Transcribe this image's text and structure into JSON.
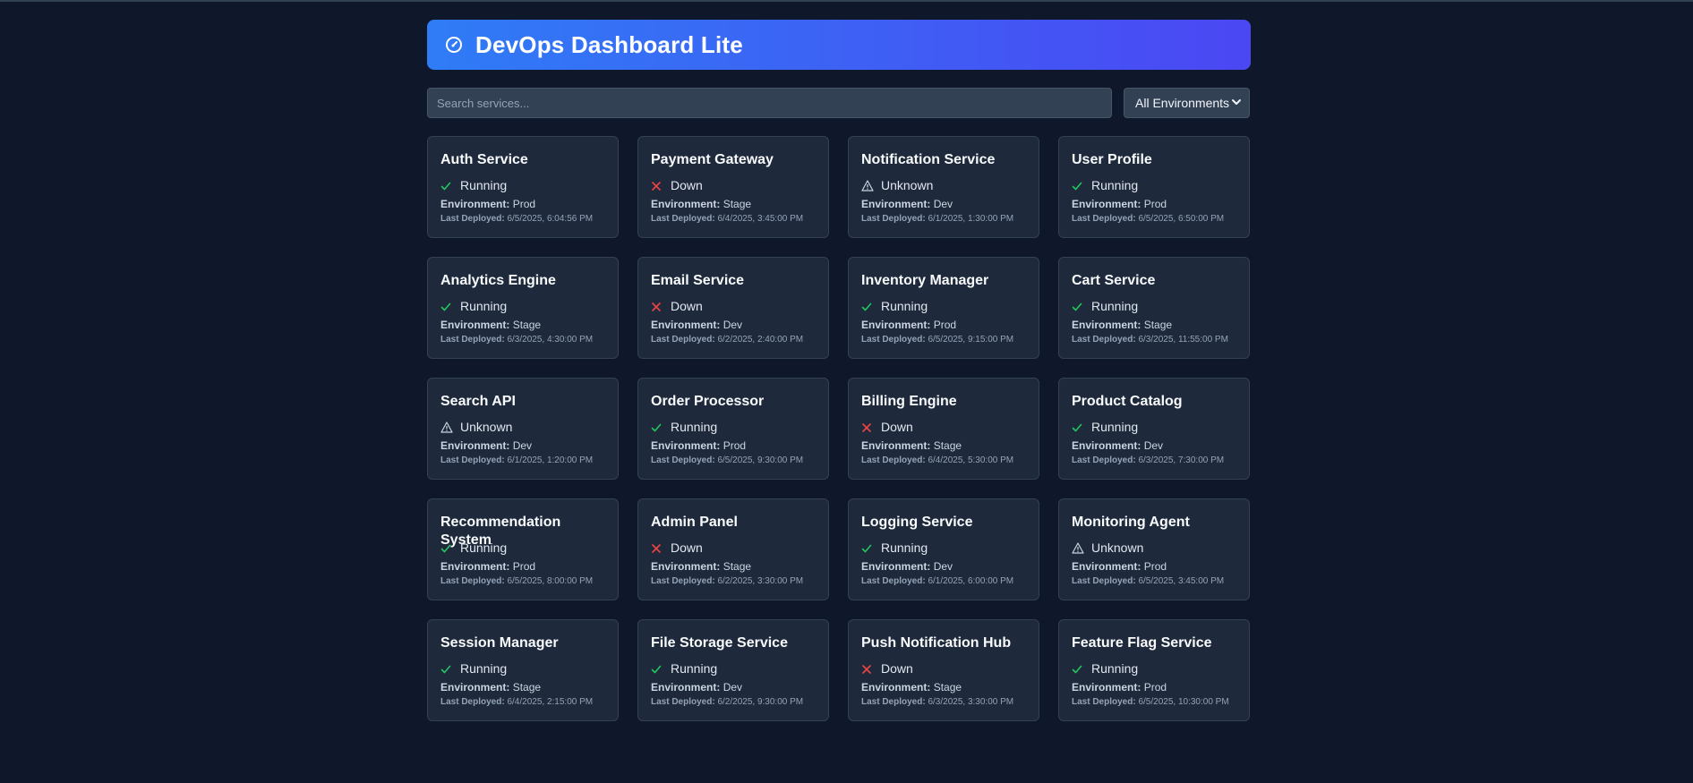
{
  "header": {
    "title": "DevOps Dashboard Lite",
    "icon": "gauge-icon"
  },
  "search": {
    "placeholder": "Search services..."
  },
  "filter": {
    "selected": "All Environments"
  },
  "labels": {
    "environment": "Environment:",
    "last_deployed": "Last Deployed:"
  },
  "colors": {
    "running": "#22c55e",
    "down": "#ef4444",
    "unknown": "#cbd5e1",
    "header_start": "#2f7cf6",
    "header_end": "#4b47f3"
  },
  "services": [
    {
      "name": "Auth Service",
      "status": "Running",
      "env": "Prod",
      "deployed": "6/5/2025, 6:04:56 PM"
    },
    {
      "name": "Payment Gateway",
      "status": "Down",
      "env": "Stage",
      "deployed": "6/4/2025, 3:45:00 PM"
    },
    {
      "name": "Notification Service",
      "status": "Unknown",
      "env": "Dev",
      "deployed": "6/1/2025, 1:30:00 PM"
    },
    {
      "name": "User Profile",
      "status": "Running",
      "env": "Prod",
      "deployed": "6/5/2025, 6:50:00 PM"
    },
    {
      "name": "Analytics Engine",
      "status": "Running",
      "env": "Stage",
      "deployed": "6/3/2025, 4:30:00 PM"
    },
    {
      "name": "Email Service",
      "status": "Down",
      "env": "Dev",
      "deployed": "6/2/2025, 2:40:00 PM"
    },
    {
      "name": "Inventory Manager",
      "status": "Running",
      "env": "Prod",
      "deployed": "6/5/2025, 9:15:00 PM"
    },
    {
      "name": "Cart Service",
      "status": "Running",
      "env": "Stage",
      "deployed": "6/3/2025, 11:55:00 PM"
    },
    {
      "name": "Search API",
      "status": "Unknown",
      "env": "Dev",
      "deployed": "6/1/2025, 1:20:00 PM"
    },
    {
      "name": "Order Processor",
      "status": "Running",
      "env": "Prod",
      "deployed": "6/5/2025, 9:30:00 PM"
    },
    {
      "name": "Billing Engine",
      "status": "Down",
      "env": "Stage",
      "deployed": "6/4/2025, 5:30:00 PM"
    },
    {
      "name": "Product Catalog",
      "status": "Running",
      "env": "Dev",
      "deployed": "6/3/2025, 7:30:00 PM"
    },
    {
      "name": "Recommendation System",
      "status": "Running",
      "env": "Prod",
      "deployed": "6/5/2025, 8:00:00 PM"
    },
    {
      "name": "Admin Panel",
      "status": "Down",
      "env": "Stage",
      "deployed": "6/2/2025, 3:30:00 PM"
    },
    {
      "name": "Logging Service",
      "status": "Running",
      "env": "Dev",
      "deployed": "6/1/2025, 6:00:00 PM"
    },
    {
      "name": "Monitoring Agent",
      "status": "Unknown",
      "env": "Prod",
      "deployed": "6/5/2025, 3:45:00 PM"
    },
    {
      "name": "Session Manager",
      "status": "Running",
      "env": "Stage",
      "deployed": "6/4/2025, 2:15:00 PM"
    },
    {
      "name": "File Storage Service",
      "status": "Running",
      "env": "Dev",
      "deployed": "6/2/2025, 9:30:00 PM"
    },
    {
      "name": "Push Notification Hub",
      "status": "Down",
      "env": "Stage",
      "deployed": "6/3/2025, 3:30:00 PM"
    },
    {
      "name": "Feature Flag Service",
      "status": "Running",
      "env": "Prod",
      "deployed": "6/5/2025, 10:30:00 PM"
    }
  ]
}
